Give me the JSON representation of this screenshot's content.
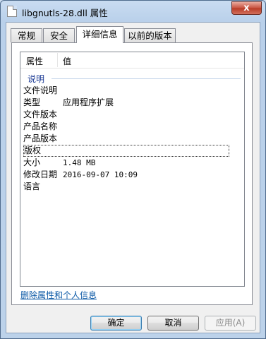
{
  "window": {
    "title": "libgnutls-28.dll 属性",
    "close_label": "x"
  },
  "tabs": [
    {
      "label": "常规"
    },
    {
      "label": "安全"
    },
    {
      "label": "详细信息",
      "active": true
    },
    {
      "label": "以前的版本"
    }
  ],
  "details": {
    "columns": {
      "property": "属性",
      "value": "值"
    },
    "group": "说明",
    "rows": [
      {
        "key": "文件说明",
        "value": ""
      },
      {
        "key": "类型",
        "value": "应用程序扩展"
      },
      {
        "key": "文件版本",
        "value": ""
      },
      {
        "key": "产品名称",
        "value": ""
      },
      {
        "key": "产品版本",
        "value": ""
      },
      {
        "key": "版权",
        "value": ""
      },
      {
        "key": "大小",
        "value": "1.48 MB"
      },
      {
        "key": "修改日期",
        "value": "2016-09-07 10:09"
      },
      {
        "key": "语言",
        "value": ""
      }
    ]
  },
  "remove_link": "删除属性和个人信息",
  "buttons": {
    "ok": "确定",
    "cancel": "取消",
    "apply": "应用(A)"
  }
}
